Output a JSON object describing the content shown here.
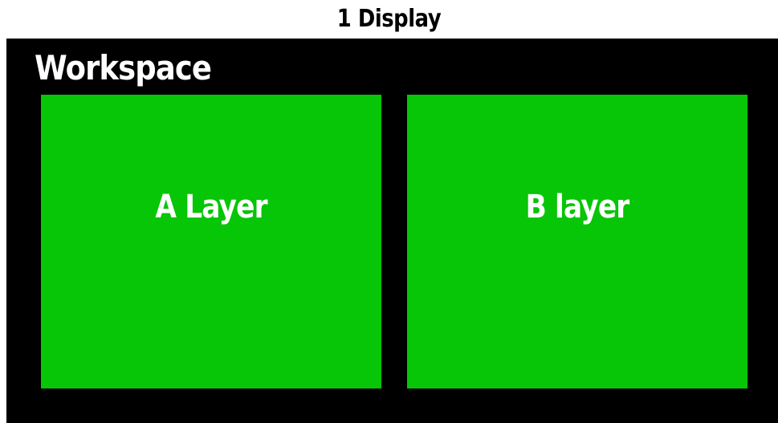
{
  "display_title": "1 Display",
  "workspace": {
    "label": "Workspace"
  },
  "layers": [
    {
      "label": "A Layer"
    },
    {
      "label": "B layer"
    }
  ],
  "colors": {
    "background": "#ffffff",
    "workspace": "#000000",
    "layer": "#07c507",
    "text_dark": "#000000",
    "text_light": "#ffffff"
  }
}
